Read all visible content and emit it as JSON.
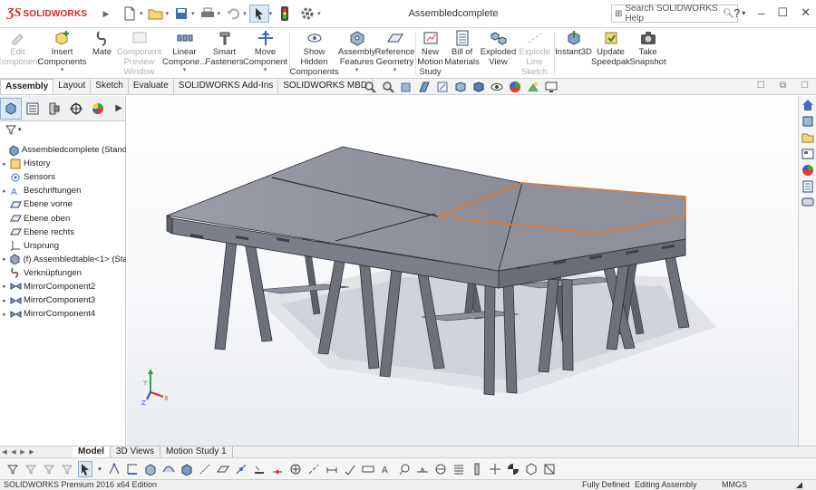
{
  "app": {
    "brand": "SOLIDWORKS",
    "window_title": "Assembledcomplete",
    "search_placeholder": "Search SOLIDWORKS Help",
    "help_label": "?"
  },
  "ribbon": [
    {
      "label": "Edit Component",
      "icon": "edit-component-icon",
      "disabled": true
    },
    {
      "label": "Insert Components",
      "icon": "insert-components-icon",
      "disabled": false,
      "dropdown": true
    },
    {
      "label": "Mate",
      "icon": "mate-icon",
      "disabled": false
    },
    {
      "label": "Component Preview Window",
      "icon": "component-preview-icon",
      "disabled": true
    },
    {
      "label": "Linear Compone...",
      "icon": "linear-pattern-icon",
      "disabled": false,
      "dropdown": true
    },
    {
      "label": "Smart Fasteners",
      "icon": "smart-fasteners-icon",
      "disabled": false
    },
    {
      "label": "Move Component",
      "icon": "move-component-icon",
      "disabled": false,
      "dropdown": true
    },
    {
      "label": "Show Hidden Components",
      "icon": "show-hidden-icon",
      "disabled": false
    },
    {
      "label": "Assembly Features",
      "icon": "assembly-features-icon",
      "disabled": false,
      "dropdown": true
    },
    {
      "label": "Reference Geometry",
      "icon": "reference-geometry-icon",
      "disabled": false,
      "dropdown": true
    },
    {
      "label": "New Motion Study",
      "icon": "motion-study-icon",
      "disabled": false
    },
    {
      "label": "Bill of Materials",
      "icon": "bill-of-materials-icon",
      "disabled": false
    },
    {
      "label": "Exploded View",
      "icon": "exploded-view-icon",
      "disabled": false
    },
    {
      "label": "Explode Line Sketch",
      "icon": "explode-line-sketch-icon",
      "disabled": true
    },
    {
      "label": "Instant3D",
      "icon": "instant3d-icon",
      "disabled": false
    },
    {
      "label": "Update Speedpak",
      "icon": "speedpak-icon",
      "disabled": false
    },
    {
      "label": "Take Snapshot",
      "icon": "camera-icon",
      "disabled": false
    }
  ],
  "command_tabs": [
    "Assembly",
    "Layout",
    "Sketch",
    "Evaluate",
    "SOLIDWORKS Add-Ins",
    "SOLIDWORKS MBD"
  ],
  "active_command_tab": "Assembly",
  "tree": [
    {
      "label": "Assembledcomplete  (Standard",
      "icon": "assembly-icon",
      "expander": ""
    },
    {
      "label": "History",
      "icon": "history-icon",
      "expander": "▸"
    },
    {
      "label": "Sensors",
      "icon": "sensor-icon",
      "expander": ""
    },
    {
      "label": "Beschriftungen",
      "icon": "annotations-icon",
      "expander": "▸"
    },
    {
      "label": "Ebene vorne",
      "icon": "plane-icon",
      "expander": ""
    },
    {
      "label": "Ebene oben",
      "icon": "plane-icon",
      "expander": ""
    },
    {
      "label": "Ebene rechts",
      "icon": "plane-icon",
      "expander": ""
    },
    {
      "label": "Ursprung",
      "icon": "origin-icon",
      "expander": ""
    },
    {
      "label": "(f) Assembledtable<1> (Sta",
      "icon": "subassembly-icon",
      "expander": "▸"
    },
    {
      "label": "Verknüpfungen",
      "icon": "mates-icon",
      "expander": ""
    },
    {
      "label": "MirrorComponent2",
      "icon": "mirror-component-icon",
      "expander": "▸"
    },
    {
      "label": "MirrorComponent3",
      "icon": "mirror-component-icon",
      "expander": "▸"
    },
    {
      "label": "MirrorComponent4",
      "icon": "mirror-component-icon",
      "expander": "▸"
    }
  ],
  "bottom_tabs": [
    "Model",
    "3D Views",
    "Motion Study 1"
  ],
  "active_bottom_tab": "Model",
  "status": {
    "product": "SOLIDWORKS Premium 2016 x64 Edition",
    "definition": "Fully Defined",
    "mode": "Editing Assembly",
    "units": "MMGS"
  },
  "colors": {
    "brand_red": "#d6261e",
    "model_gray": "#8c8e99",
    "selection_orange": "#e27a2b",
    "active_tab_blue": "#dbe7f5"
  }
}
